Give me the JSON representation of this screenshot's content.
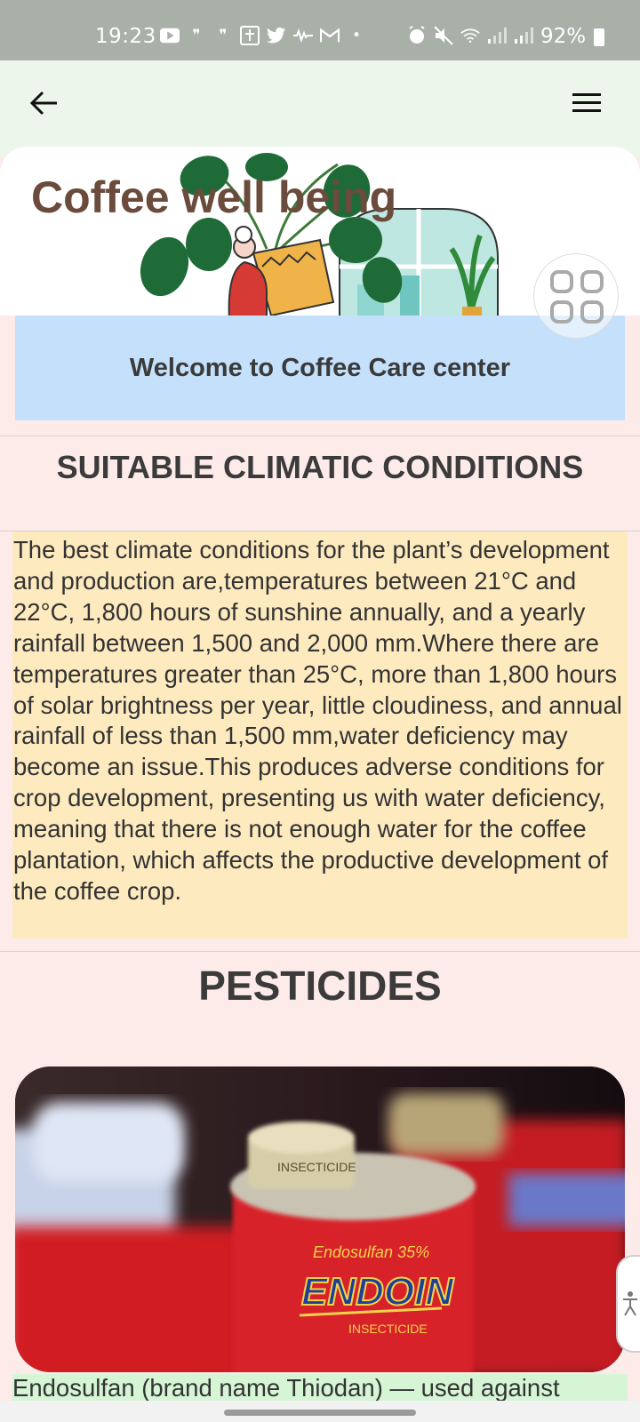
{
  "status_bar": {
    "time": "19:23",
    "battery": "92%",
    "left_icons": [
      "youtube-icon",
      "quote-icon",
      "quote-icon",
      "bible-app-icon",
      "twitter-icon",
      "audio-icon",
      "gmail-icon",
      "dot-icon"
    ],
    "right_icons": [
      "alarm-icon",
      "mute-icon",
      "wifi-icon",
      "signal-icon",
      "signal-icon"
    ]
  },
  "app_bar": {
    "back_icon": "arrow-left-icon",
    "menu_icon": "hamburger-menu-icon"
  },
  "hero": {
    "title": "Coffee well being"
  },
  "welcome": {
    "text": "Welcome to Coffee Care center"
  },
  "sections": {
    "climate_heading": "SUITABLE CLIMATIC CONDITIONS",
    "climate_text": "The best climate conditions for the plant’s development and production are,temperatures between 21°C and 22°C, 1,800 hours of sunshine annually, and a yearly rainfall between 1,500 and 2,000 mm.Where there are temperatures greater than 25°C, more than 1,800 hours of solar brightness per year, little cloudiness, and annual rainfall of less than 1,500 mm,water deficiency may become an issue.This produces adverse conditions for crop development, presenting us with water deficiency, meaning that there is not enough water for the coffee plantation, which affects the productive development of the coffee crop.",
    "pesticides_heading": "PESTICIDES",
    "pesticide_caption": "Endosulfan (brand name Thiodan) — used against"
  },
  "pesticide_image": {
    "can_label_brand": "ENDOIN",
    "can_label_small": "Endosulfan 35%",
    "can_label_type": "INSECTICIDE",
    "lid_text": "INSECTICIDE"
  },
  "colors": {
    "status_bar": "#a8b0a8",
    "app_bar": "#edf6ea",
    "page_bg": "#fcebe8",
    "title_brown": "#6a4b3c",
    "welcome_bg": "#c4e0fb",
    "climate_bg": "#fdeabf",
    "caption_bg": "#d5f5d5"
  }
}
